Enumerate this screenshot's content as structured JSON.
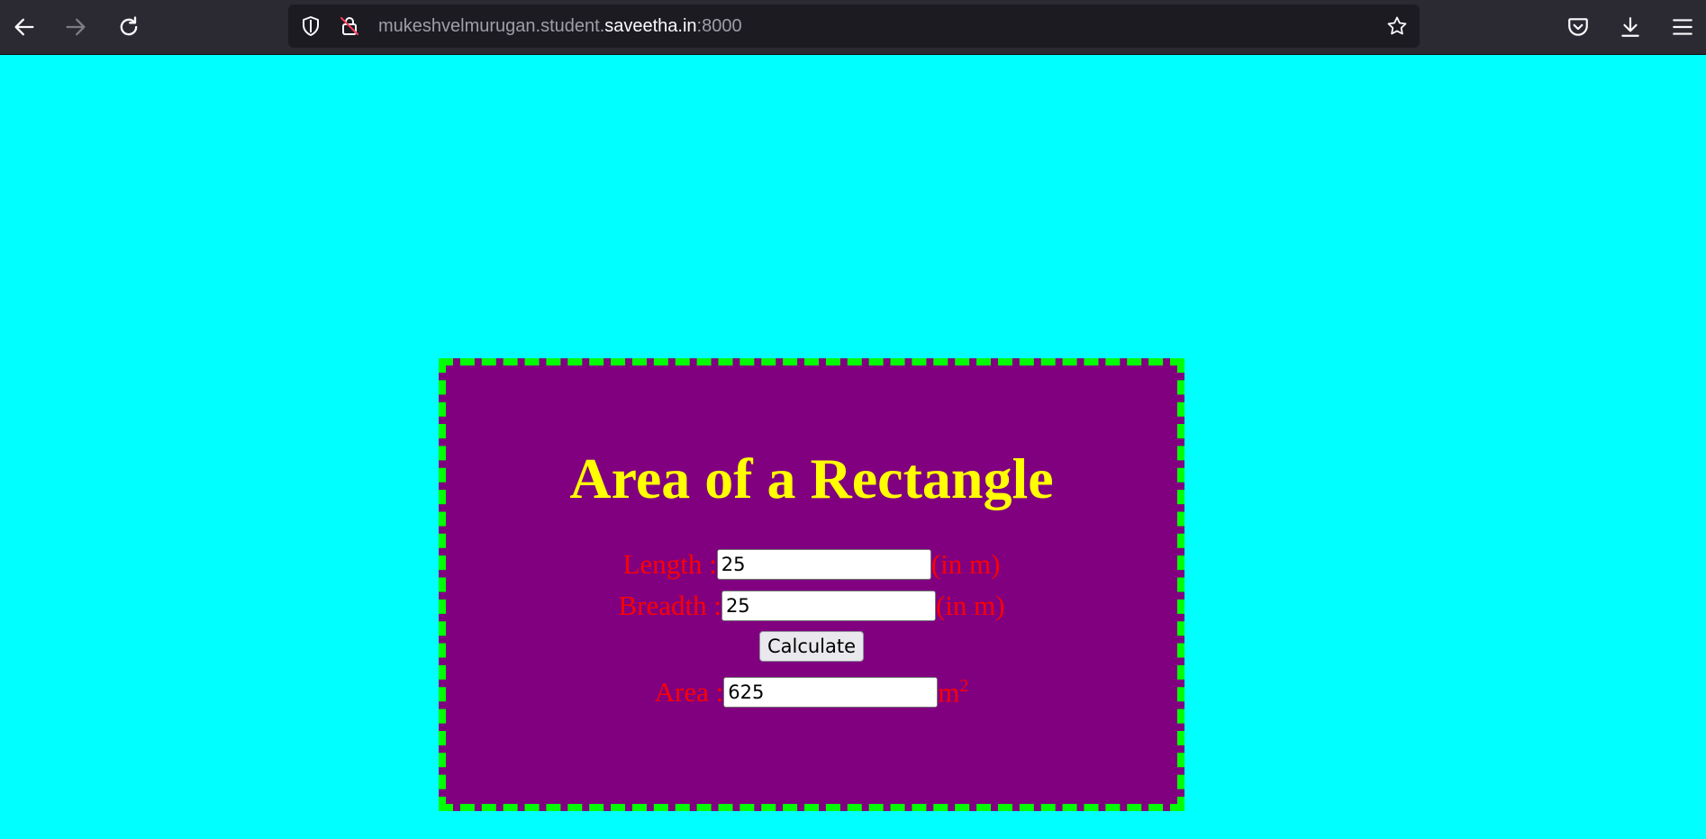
{
  "browser": {
    "url_prefix": "mukeshvelmurugan.student.",
    "url_host": "saveetha.in",
    "url_suffix": ":8000"
  },
  "page": {
    "title": "Area of a Rectangle",
    "length_label": "Length : ",
    "length_value": "25",
    "length_unit": "(in m)",
    "breadth_label": "Breadth : ",
    "breadth_value": "25",
    "breadth_unit": "(in m)",
    "calculate_label": "Calculate",
    "area_label": "Area : ",
    "area_value": "625",
    "area_unit": "m",
    "area_unit_exp": "2"
  },
  "colors": {
    "background": "#00ffff",
    "card": "#800080",
    "border": "#00ff00",
    "title": "#ffff00",
    "labels": "#ff0000"
  }
}
